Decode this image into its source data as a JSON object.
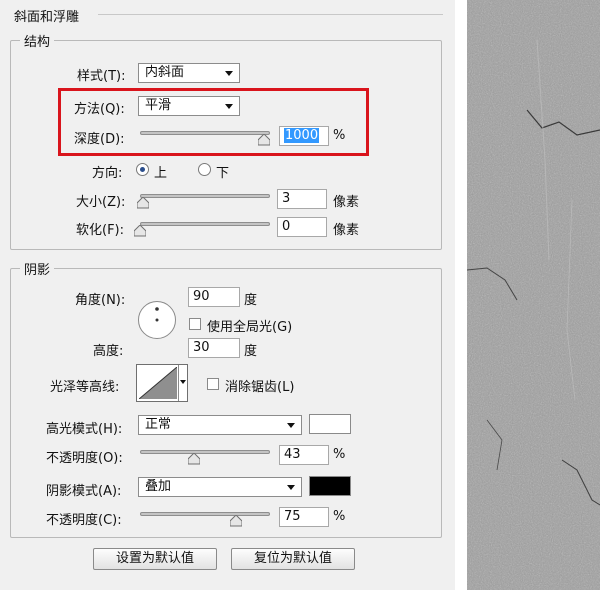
{
  "section_title": "斜面和浮雕",
  "structure": {
    "legend": "结构",
    "style_label": "样式(T):",
    "style_value": "内斜面",
    "method_label": "方法(Q):",
    "method_value": "平滑",
    "depth_label": "深度(D):",
    "depth_value": "1000",
    "depth_unit": "%",
    "depth_level": 1.0,
    "direction_label": "方向:",
    "direction_up": "上",
    "direction_down": "下",
    "size_label": "大小(Z):",
    "size_value": "3",
    "size_unit": "像素",
    "soften_label": "软化(F):",
    "soften_value": "0",
    "soften_unit": "像素"
  },
  "shading": {
    "legend": "阴影",
    "angle_label": "角度(N):",
    "angle_value": "90",
    "angle_unit": "度",
    "global_light_label": "使用全局光(G)",
    "global_light_checked": false,
    "altitude_label": "高度:",
    "altitude_value": "30",
    "altitude_unit": "度",
    "gloss_contour_label": "光泽等高线:",
    "anti_alias_label": "消除锯齿(L)",
    "anti_alias_checked": false,
    "highlight_mode_label": "高光模式(H):",
    "highlight_mode_value": "正常",
    "highlight_color": "#ffffff",
    "highlight_opacity_label": "不透明度(O):",
    "highlight_opacity_value": "43",
    "highlight_opacity_unit": "%",
    "shadow_mode_label": "阴影模式(A):",
    "shadow_mode_value": "叠加",
    "shadow_color": "#000000",
    "shadow_opacity_label": "不透明度(C):",
    "shadow_opacity_value": "75",
    "shadow_opacity_unit": "%"
  },
  "buttons": {
    "make_default": "设置为默认值",
    "reset_default": "复位为默认值"
  },
  "colors": {
    "highlight_box": "#d9141c",
    "selection": "#3399ff"
  }
}
